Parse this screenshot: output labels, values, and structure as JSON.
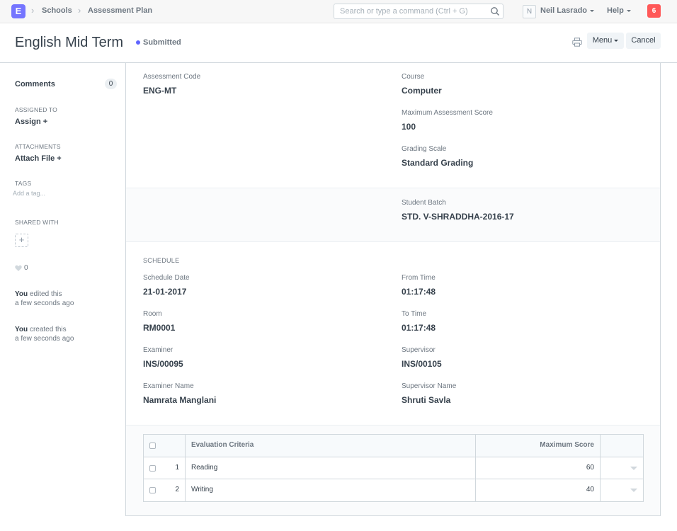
{
  "navbar": {
    "logo": "E",
    "breadcrumbs": [
      "Schools",
      "Assessment Plan"
    ],
    "search_placeholder": "Search or type a command (Ctrl + G)",
    "avatar_initial": "N",
    "user_name": "Neil Lasrado",
    "help_label": "Help",
    "notification_count": "6"
  },
  "page": {
    "title": "English Mid Term",
    "status": "Submitted",
    "menu_label": "Menu",
    "cancel_label": "Cancel"
  },
  "sidebar": {
    "comments_label": "Comments",
    "comments_count": "0",
    "assigned_to_label": "ASSIGNED TO",
    "assign_label": "Assign",
    "attachments_label": "ATTACHMENTS",
    "attach_label": "Attach File",
    "tags_label": "TAGS",
    "tag_placeholder": "Add a tag...",
    "shared_with_label": "SHARED WITH",
    "likes": "0",
    "activity": [
      {
        "actor": "You",
        "action": "edited this",
        "time": "a few seconds ago"
      },
      {
        "actor": "You",
        "action": "created this",
        "time": "a few seconds ago"
      }
    ]
  },
  "form": {
    "assessment_code_label": "Assessment Code",
    "assessment_code": "ENG-MT",
    "course_label": "Course",
    "course": "Computer",
    "max_score_label": "Maximum Assessment Score",
    "max_score": "100",
    "grading_scale_label": "Grading Scale",
    "grading_scale": "Standard Grading",
    "student_batch_label": "Student Batch",
    "student_batch": "STD. V-SHRADDHA-2016-17",
    "schedule_title": "SCHEDULE",
    "schedule_date_label": "Schedule Date",
    "schedule_date": "21-01-2017",
    "from_time_label": "From Time",
    "from_time": "01:17:48",
    "room_label": "Room",
    "room": "RM0001",
    "to_time_label": "To Time",
    "to_time": "01:17:48",
    "examiner_label": "Examiner",
    "examiner": "INS/00095",
    "supervisor_label": "Supervisor",
    "supervisor": "INS/00105",
    "examiner_name_label": "Examiner Name",
    "examiner_name": "Namrata Manglani",
    "supervisor_name_label": "Supervisor Name",
    "supervisor_name": "Shruti Savla"
  },
  "grid": {
    "headers": [
      "Evaluation Criteria",
      "Maximum Score"
    ],
    "rows": [
      {
        "idx": "1",
        "criteria": "Reading",
        "score": "60"
      },
      {
        "idx": "2",
        "criteria": "Writing",
        "score": "40"
      }
    ]
  }
}
